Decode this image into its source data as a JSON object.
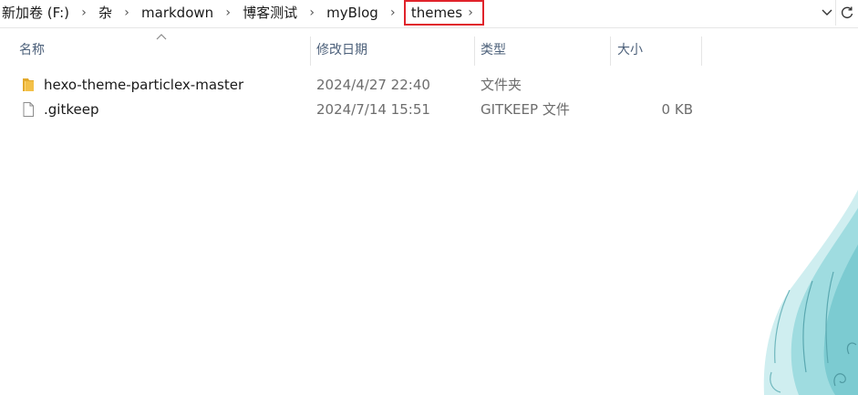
{
  "breadcrumb": {
    "items": [
      {
        "label": "新加卷 (F:)"
      },
      {
        "label": "杂"
      },
      {
        "label": "markdown"
      },
      {
        "label": "博客测试"
      },
      {
        "label": "myBlog"
      }
    ],
    "current": "themes",
    "separator": "›"
  },
  "columns": {
    "name": "名称",
    "modified": "修改日期",
    "type": "类型",
    "size": "大小"
  },
  "files": [
    {
      "name": "hexo-theme-particlex-master",
      "modified": "2024/4/27 22:40",
      "type": "文件夹",
      "size": "",
      "icon": "folder-icon"
    },
    {
      "name": ".gitkeep",
      "modified": "2024/7/14 15:51",
      "type": "GITKEEP 文件",
      "size": "0 KB",
      "icon": "file-icon"
    }
  ],
  "colors": {
    "highlight_border": "#e0232b",
    "header_text": "#4c607a",
    "folder": "#f3c048"
  }
}
